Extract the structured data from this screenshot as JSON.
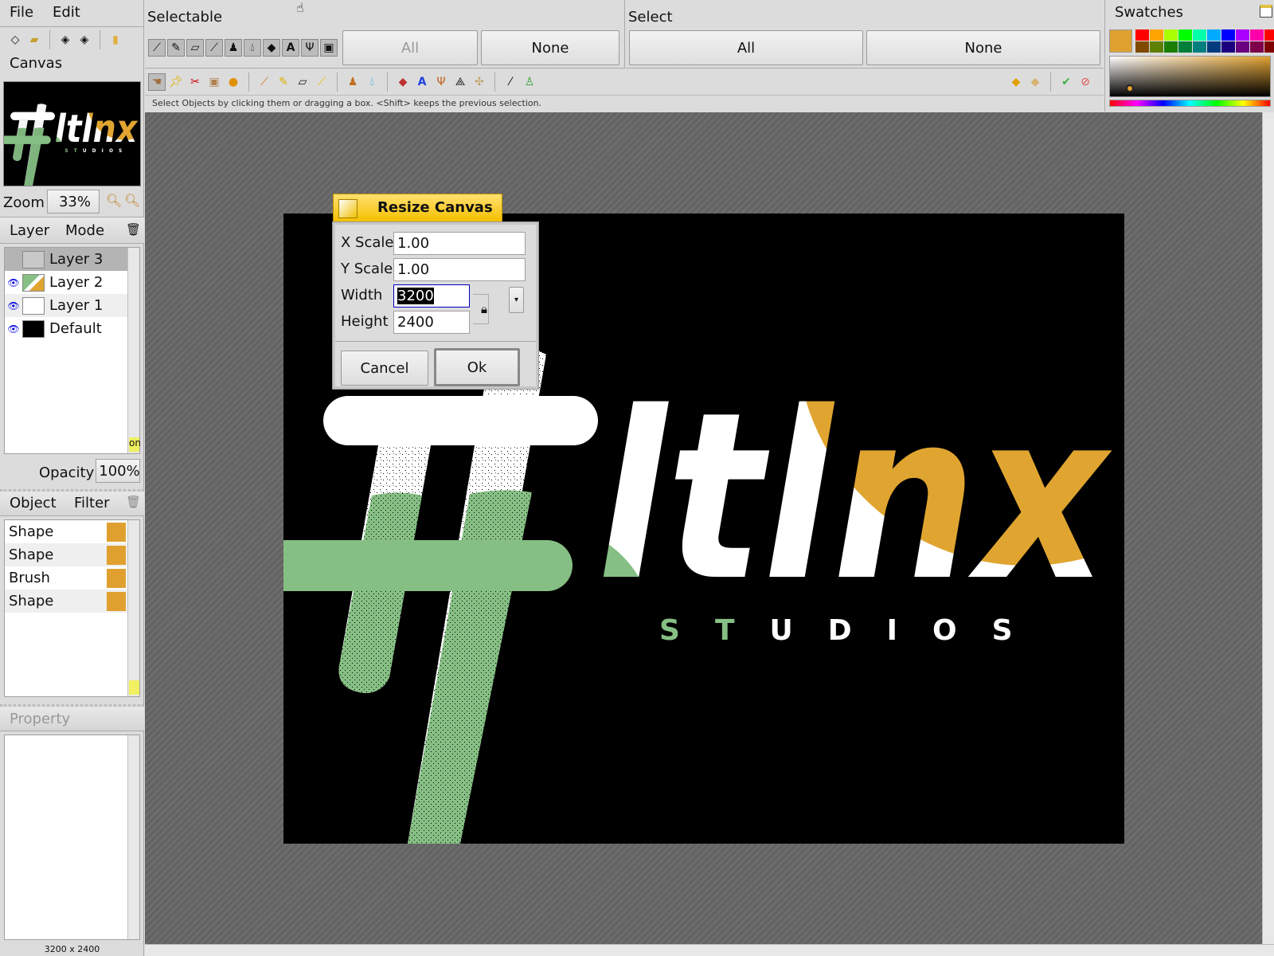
{
  "menu": {
    "file": "File",
    "edit": "Edit"
  },
  "left": {
    "canvas_label": "Canvas",
    "zoom_label": "Zoom",
    "zoom_value": "33%",
    "layer_tab": "Layer",
    "mode_tab": "Mode",
    "layers": [
      {
        "name": "Layer 3",
        "visible": false,
        "selected": true
      },
      {
        "name": "Layer 2",
        "visible": true
      },
      {
        "name": "Layer 1",
        "visible": true
      },
      {
        "name": "Default",
        "visible": true
      }
    ],
    "opacity_label": "Opacity",
    "opacity_value": "100%",
    "object_tab": "Object",
    "filter_tab": "Filter",
    "objects": [
      {
        "name": "Shape"
      },
      {
        "name": "Shape"
      },
      {
        "name": "Brush"
      },
      {
        "name": "Shape"
      }
    ],
    "property_label": "Property",
    "status_size": "3200 x 2400"
  },
  "top": {
    "selectable_label": "Selectable",
    "selectable_all": "All",
    "selectable_none": "None",
    "select_label": "Select",
    "select_all": "All",
    "select_none": "None",
    "hint": "Select Objects by clicking them or dragging a box. <Shift> keeps the previous selection."
  },
  "swatches": {
    "title": "Swatches",
    "current": "#e0a030",
    "row1": [
      "#ff0000",
      "#ffa500",
      "#aaff00",
      "#00ff00",
      "#00ffaa",
      "#00aaff",
      "#0000ff",
      "#aa00ff",
      "#ff00aa",
      "#ff0000"
    ],
    "row2": [
      "#7f4a00",
      "#5f7f00",
      "#1a7f00",
      "#007f3a",
      "#007f7f",
      "#003a7f",
      "#1a007f",
      "#6a007f",
      "#7f004a",
      "#7f0000"
    ]
  },
  "dialog": {
    "title": "Resize Canvas",
    "x_scale_label": "X Scale",
    "x_scale": "1.00",
    "y_scale_label": "Y Scale",
    "y_scale": "1.00",
    "width_label": "Width",
    "width": "3200",
    "height_label": "Height",
    "height": "2400",
    "cancel": "Cancel",
    "ok": "Ok"
  },
  "logo": {
    "brand": "ltlnx",
    "sub": "STUDIOS"
  },
  "colors": {
    "gold": "#e0a530",
    "green": "#86bf84"
  }
}
